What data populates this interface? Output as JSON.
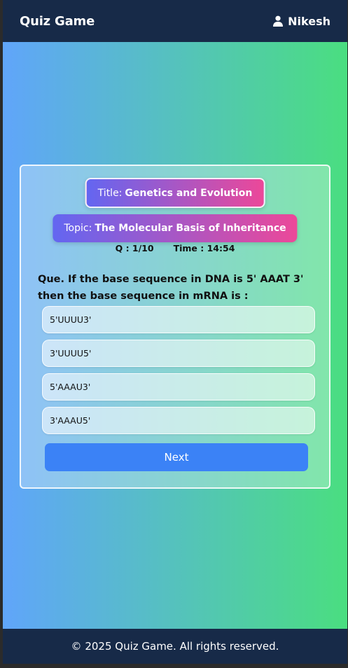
{
  "navbar": {
    "brand": "Quiz Game",
    "username": "Nikesh",
    "user_icon": "user-icon"
  },
  "quiz": {
    "title_label": "Title:",
    "title_value": "Genetics and Evolution",
    "topic_label": "Topic:",
    "topic_value": "The Molecular Basis of Inheritance",
    "progress": "Q : 1/10",
    "timer": "Time : 14:54",
    "question": "Que. If the base sequence in DNA is 5' AAAT 3' then the base sequence in mRNA is :",
    "options": [
      "5'UUUU3'",
      "3'UUUU5'",
      "5'AAAU3'",
      "3'AAAU5'"
    ],
    "next_label": "Next"
  },
  "footer": {
    "text": "© 2025 Quiz Game. All rights reserved."
  },
  "colors": {
    "navbar_bg": "#172a48",
    "gradient_start": "#60a5fa",
    "gradient_end": "#4ade80",
    "pill_start": "#6366f1",
    "pill_end": "#ec4899",
    "button": "#3b82f6"
  }
}
